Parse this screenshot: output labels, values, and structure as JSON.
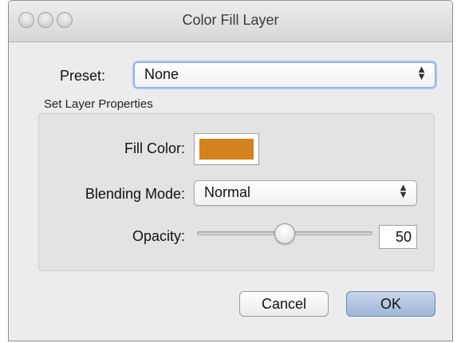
{
  "window": {
    "title": "Color Fill Layer"
  },
  "preset": {
    "label": "Preset:",
    "selected": "None"
  },
  "properties": {
    "section_label": "Set Layer Properties",
    "fill_color": {
      "label": "Fill Color:",
      "color": "#d4821d"
    },
    "blending_mode": {
      "label": "Blending Mode:",
      "selected": "Normal"
    },
    "opacity": {
      "label": "Opacity:",
      "value": "50",
      "fraction": 0.5
    }
  },
  "buttons": {
    "cancel": "Cancel",
    "ok": "OK"
  },
  "icons": {
    "popup_arrows": "up-down-arrows-icon",
    "window_controls": [
      "close-icon",
      "minimize-icon",
      "zoom-icon"
    ]
  }
}
